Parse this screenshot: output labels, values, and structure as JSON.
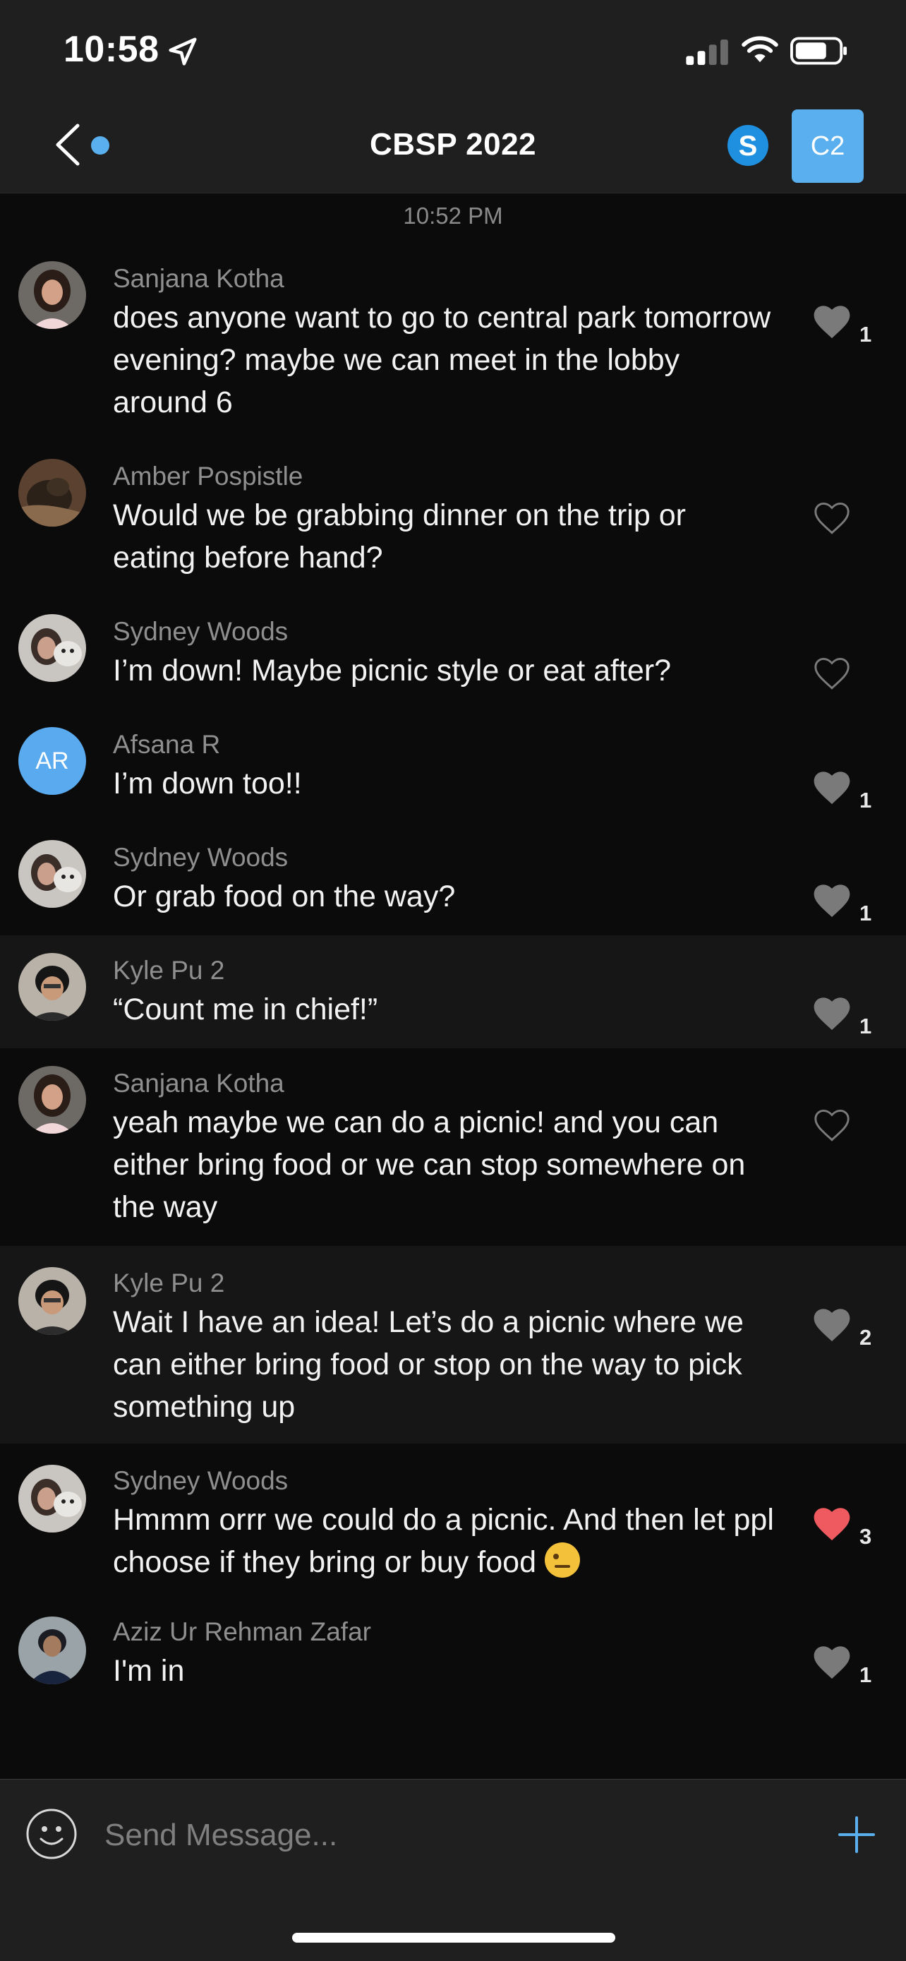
{
  "status_bar": {
    "time": "10:58"
  },
  "nav": {
    "title": "CBSP 2022",
    "group_badge": "C2"
  },
  "chat": {
    "timestamp": "10:52 PM",
    "messages": [
      {
        "sender": "Sanjana Kotha",
        "text": "does anyone want to go to central park tomorrow evening? maybe we can meet in the lobby around 6",
        "likes": "1",
        "liked_by_me": false
      },
      {
        "sender": "Amber Pospistle",
        "text": "Would we be grabbing dinner on the trip or eating before hand?",
        "likes": "",
        "liked_by_me": false
      },
      {
        "sender": "Sydney Woods",
        "text": "I’m down! Maybe picnic style or eat after?",
        "likes": "",
        "liked_by_me": false
      },
      {
        "sender": "Afsana R",
        "avatar_initials": "AR",
        "text": "I’m down too!!",
        "likes": "1",
        "liked_by_me": false
      },
      {
        "sender": "Sydney Woods",
        "text": "Or grab food on the way?",
        "likes": "1",
        "liked_by_me": false
      },
      {
        "sender": "Kyle Pu 2",
        "text": "“Count me in chief!”",
        "likes": "1",
        "liked_by_me": false
      },
      {
        "sender": "Sanjana Kotha",
        "text": "yeah maybe we can do a picnic! and you can either bring food or we can stop somewhere on the way",
        "likes": "",
        "liked_by_me": false
      },
      {
        "sender": "Kyle Pu 2",
        "text": "Wait I have an idea! Let’s do a picnic where we can either bring food or stop on the way to pick something up",
        "likes": "2",
        "liked_by_me": false
      },
      {
        "sender": "Sydney Woods",
        "text": "Hmmm orrr we could do a picnic. And then let ppl choose if they bring or buy food",
        "emoji": "raised-eyebrow-emoji",
        "likes": "3",
        "liked_by_me": true
      },
      {
        "sender": "Aziz Ur Rehman Zafar",
        "text": "I'm in",
        "likes": "1",
        "liked_by_me": false
      }
    ]
  },
  "composer": {
    "placeholder": "Send Message..."
  },
  "colors": {
    "accent": "#5ab0ee",
    "like_active": "#ee5a5f",
    "like_filled": "#7a7a7a",
    "background": "#0b0b0b",
    "bar": "#1f1f1f"
  },
  "icons": [
    "back-arrow-icon",
    "unread-dot-icon",
    "skype-icon",
    "location-arrow-icon",
    "signal-icon",
    "wifi-icon",
    "battery-icon",
    "heart-icon",
    "smiley-icon",
    "plus-icon"
  ]
}
